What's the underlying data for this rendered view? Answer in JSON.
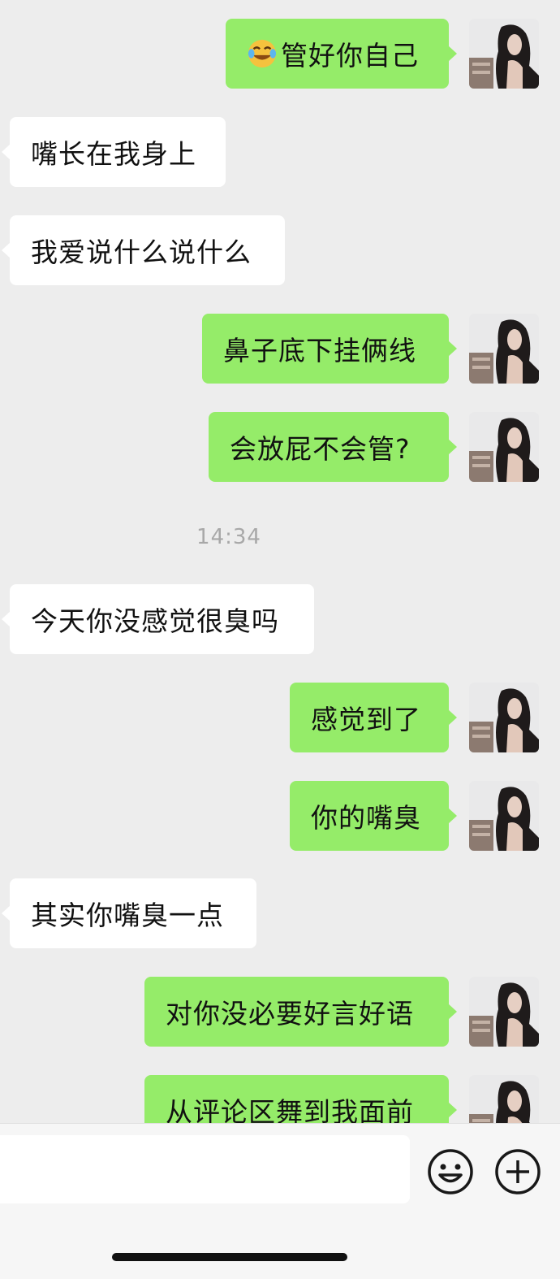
{
  "conversation": {
    "messages": [
      {
        "from": "me",
        "text": "管好你自己",
        "emoji": "rolling-on-floor-laughing-emoji"
      },
      {
        "from": "other",
        "text": "嘴长在我身上"
      },
      {
        "from": "other",
        "text": "我爱说什么说什么"
      },
      {
        "from": "me",
        "text": "鼻子底下挂俩线"
      },
      {
        "from": "me",
        "text": "会放屁不会管?"
      },
      {
        "from": "other",
        "text": "今天你没感觉很臭吗"
      },
      {
        "from": "me",
        "text": "感觉到了"
      },
      {
        "from": "me",
        "text": "你的嘴臭"
      },
      {
        "from": "other",
        "text": "其实你嘴臭一点"
      },
      {
        "from": "me",
        "text": "对你没必要好言好语"
      },
      {
        "from": "me",
        "text": "从评论区舞到我面前"
      }
    ],
    "timestamp": "14:34"
  },
  "input_bar": {
    "text_value": "",
    "emoji_icon": "smiley-face-icon",
    "more_icon": "plus-circle-icon"
  },
  "colors": {
    "background": "#ededed",
    "my_bubble": "#95ec69",
    "other_bubble": "#ffffff",
    "timestamp_text": "#a8a8a8"
  }
}
